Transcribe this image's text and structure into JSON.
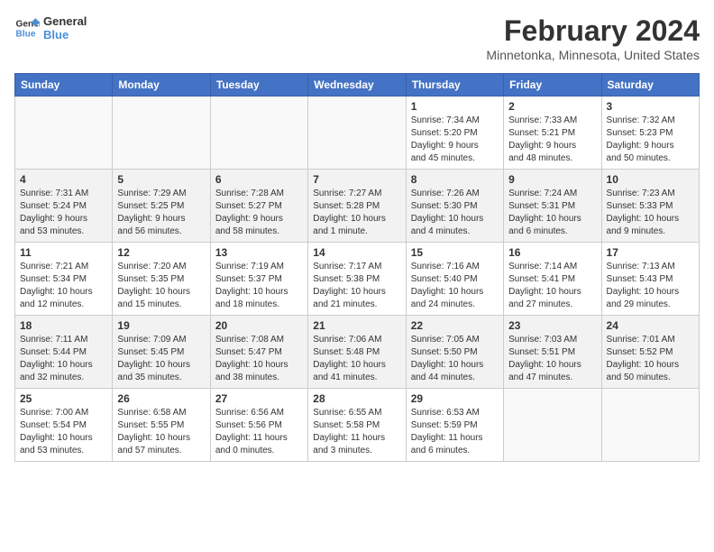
{
  "header": {
    "logo_line1": "General",
    "logo_line2": "Blue",
    "month": "February 2024",
    "location": "Minnetonka, Minnesota, United States"
  },
  "days_of_week": [
    "Sunday",
    "Monday",
    "Tuesday",
    "Wednesday",
    "Thursday",
    "Friday",
    "Saturday"
  ],
  "weeks": [
    [
      {
        "day": "",
        "info": ""
      },
      {
        "day": "",
        "info": ""
      },
      {
        "day": "",
        "info": ""
      },
      {
        "day": "",
        "info": ""
      },
      {
        "day": "1",
        "info": "Sunrise: 7:34 AM\nSunset: 5:20 PM\nDaylight: 9 hours\nand 45 minutes."
      },
      {
        "day": "2",
        "info": "Sunrise: 7:33 AM\nSunset: 5:21 PM\nDaylight: 9 hours\nand 48 minutes."
      },
      {
        "day": "3",
        "info": "Sunrise: 7:32 AM\nSunset: 5:23 PM\nDaylight: 9 hours\nand 50 minutes."
      }
    ],
    [
      {
        "day": "4",
        "info": "Sunrise: 7:31 AM\nSunset: 5:24 PM\nDaylight: 9 hours\nand 53 minutes."
      },
      {
        "day": "5",
        "info": "Sunrise: 7:29 AM\nSunset: 5:25 PM\nDaylight: 9 hours\nand 56 minutes."
      },
      {
        "day": "6",
        "info": "Sunrise: 7:28 AM\nSunset: 5:27 PM\nDaylight: 9 hours\nand 58 minutes."
      },
      {
        "day": "7",
        "info": "Sunrise: 7:27 AM\nSunset: 5:28 PM\nDaylight: 10 hours\nand 1 minute."
      },
      {
        "day": "8",
        "info": "Sunrise: 7:26 AM\nSunset: 5:30 PM\nDaylight: 10 hours\nand 4 minutes."
      },
      {
        "day": "9",
        "info": "Sunrise: 7:24 AM\nSunset: 5:31 PM\nDaylight: 10 hours\nand 6 minutes."
      },
      {
        "day": "10",
        "info": "Sunrise: 7:23 AM\nSunset: 5:33 PM\nDaylight: 10 hours\nand 9 minutes."
      }
    ],
    [
      {
        "day": "11",
        "info": "Sunrise: 7:21 AM\nSunset: 5:34 PM\nDaylight: 10 hours\nand 12 minutes."
      },
      {
        "day": "12",
        "info": "Sunrise: 7:20 AM\nSunset: 5:35 PM\nDaylight: 10 hours\nand 15 minutes."
      },
      {
        "day": "13",
        "info": "Sunrise: 7:19 AM\nSunset: 5:37 PM\nDaylight: 10 hours\nand 18 minutes."
      },
      {
        "day": "14",
        "info": "Sunrise: 7:17 AM\nSunset: 5:38 PM\nDaylight: 10 hours\nand 21 minutes."
      },
      {
        "day": "15",
        "info": "Sunrise: 7:16 AM\nSunset: 5:40 PM\nDaylight: 10 hours\nand 24 minutes."
      },
      {
        "day": "16",
        "info": "Sunrise: 7:14 AM\nSunset: 5:41 PM\nDaylight: 10 hours\nand 27 minutes."
      },
      {
        "day": "17",
        "info": "Sunrise: 7:13 AM\nSunset: 5:43 PM\nDaylight: 10 hours\nand 29 minutes."
      }
    ],
    [
      {
        "day": "18",
        "info": "Sunrise: 7:11 AM\nSunset: 5:44 PM\nDaylight: 10 hours\nand 32 minutes."
      },
      {
        "day": "19",
        "info": "Sunrise: 7:09 AM\nSunset: 5:45 PM\nDaylight: 10 hours\nand 35 minutes."
      },
      {
        "day": "20",
        "info": "Sunrise: 7:08 AM\nSunset: 5:47 PM\nDaylight: 10 hours\nand 38 minutes."
      },
      {
        "day": "21",
        "info": "Sunrise: 7:06 AM\nSunset: 5:48 PM\nDaylight: 10 hours\nand 41 minutes."
      },
      {
        "day": "22",
        "info": "Sunrise: 7:05 AM\nSunset: 5:50 PM\nDaylight: 10 hours\nand 44 minutes."
      },
      {
        "day": "23",
        "info": "Sunrise: 7:03 AM\nSunset: 5:51 PM\nDaylight: 10 hours\nand 47 minutes."
      },
      {
        "day": "24",
        "info": "Sunrise: 7:01 AM\nSunset: 5:52 PM\nDaylight: 10 hours\nand 50 minutes."
      }
    ],
    [
      {
        "day": "25",
        "info": "Sunrise: 7:00 AM\nSunset: 5:54 PM\nDaylight: 10 hours\nand 53 minutes."
      },
      {
        "day": "26",
        "info": "Sunrise: 6:58 AM\nSunset: 5:55 PM\nDaylight: 10 hours\nand 57 minutes."
      },
      {
        "day": "27",
        "info": "Sunrise: 6:56 AM\nSunset: 5:56 PM\nDaylight: 11 hours\nand 0 minutes."
      },
      {
        "day": "28",
        "info": "Sunrise: 6:55 AM\nSunset: 5:58 PM\nDaylight: 11 hours\nand 3 minutes."
      },
      {
        "day": "29",
        "info": "Sunrise: 6:53 AM\nSunset: 5:59 PM\nDaylight: 11 hours\nand 6 minutes."
      },
      {
        "day": "",
        "info": ""
      },
      {
        "day": "",
        "info": ""
      }
    ]
  ]
}
